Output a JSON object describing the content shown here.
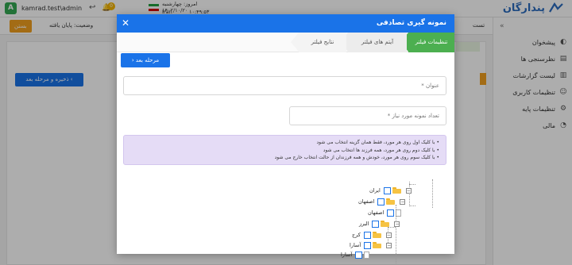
{
  "topbar": {
    "user_initial": "A",
    "username": "kamrad.test\\admin",
    "notification_count": "0",
    "date_line": "امروز: چهارشنبه ۱۴۰۲/۱۰/۲۰",
    "time_line": "۱۰:۴۹:۵۳",
    "country": "Iran",
    "brand": "پندارگان"
  },
  "sidebar": {
    "items": [
      {
        "label": "پیشخوان",
        "icon": "dashboard-icon"
      },
      {
        "label": "نظرسنجی ها",
        "icon": "survey-icon"
      },
      {
        "label": "لیست گزارشات",
        "icon": "reports-icon"
      },
      {
        "label": "تنظیمات کاربری",
        "icon": "user-settings-icon"
      },
      {
        "label": "تنظیمات پایه",
        "icon": "gear-icon"
      },
      {
        "label": "مالی",
        "icon": "finance-icon"
      }
    ]
  },
  "subbar": {
    "close_label": "بستن",
    "status": "وضعیت: پایان یافته",
    "tab_fragment": "تست"
  },
  "background": {
    "save_next_label": "ذخیره و مرحله بعد"
  },
  "modal": {
    "title": "نمونه گیری تصادفی",
    "steps": [
      "تنظیمات فیلتر",
      "آیتم های فیلتر",
      "نتایج فیلتر"
    ],
    "next_label": "مرحله بعد",
    "title_placeholder": "عنوان *",
    "count_placeholder": "تعداد نمونه مورد نیاز *",
    "info": [
      "با کلیک اول روی هر مورد، فقط همان گزینه انتخاب می شود",
      "با کلیک دوم روی هر مورد، همه فرزند ها انتخاب می شود",
      "با کلیک سوم روی هر مورد، خودش و همه فرزندان از حالت انتخاب خارج می شود"
    ],
    "tree": {
      "n1": "ایران",
      "n2": "اصفهان",
      "n3": "اصفهان",
      "n4": "البرز",
      "n5": "کرج",
      "n6": "آسارا",
      "n7": "آسارا"
    }
  },
  "colors": {
    "primary": "#1a73e8",
    "success": "#4caf50",
    "warning": "#f0a020",
    "info_bg": "#e5dcf6"
  }
}
